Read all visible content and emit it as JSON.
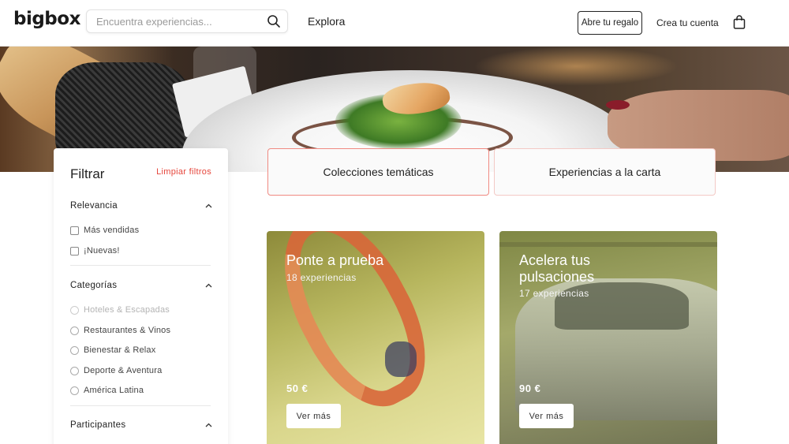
{
  "header": {
    "logo": "bigbox",
    "search_placeholder": "Encuentra experiencias...",
    "nav_explore": "Explora",
    "gift_button": "Abre tu regalo",
    "account_link": "Crea tu cuenta",
    "icons": {
      "search": "search-icon",
      "bag": "shopping-bag-icon"
    }
  },
  "hero": {
    "image": "gourmet-dish-restaurant-table"
  },
  "filters": {
    "title": "Filtrar",
    "clear": "Limpiar filtros",
    "clear_color": "#e6463c",
    "relevance": {
      "title": "Relevancia",
      "options": [
        "Más vendidas",
        "¡Nuevas!"
      ]
    },
    "categories": {
      "title": "Categorías",
      "options": [
        "Hoteles & Escapadas",
        "Restaurantes & Vinos",
        "Bienestar & Relax",
        "Deporte & Aventura",
        "América Latina"
      ]
    },
    "participants": {
      "title": "Participantes"
    }
  },
  "tabs": [
    "Colecciones temáticas",
    "Experiencias a la carta"
  ],
  "cards": [
    {
      "title": "Ponte a prueba",
      "count": "18 experiencias",
      "price": "50 €",
      "button": "Ver más"
    },
    {
      "title": "Acelera tus pulsaciones",
      "count": "17 experiencias",
      "price": "90 €",
      "button": "Ver más"
    }
  ]
}
